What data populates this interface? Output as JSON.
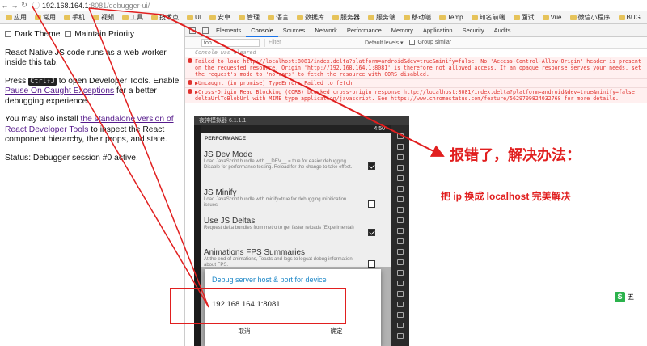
{
  "browser": {
    "url_host": "192.168.164.1",
    "url_path": ":8081/debugger-ui/",
    "bookmarks": [
      "应用",
      "常用",
      "手机",
      "视频",
      "工具",
      "技术点",
      "UI",
      "安卓",
      "管理",
      "语言",
      "数据库",
      "服务器",
      "服务端",
      "移动端",
      "Temp",
      "知名前端",
      "面试",
      "Vue",
      "微信小程序",
      "BUG"
    ]
  },
  "page": {
    "dark_theme": "Dark Theme",
    "maintain_priority": "Maintain Priority",
    "intro": "React Native JS code runs as a web worker inside this tab.",
    "press": "Press ",
    "shortcut": "Ctrl⇧J",
    "to_open": " to open Developer Tools. Enable ",
    "pause_link": "Pause On Caught Exceptions",
    "better": " for a better debugging experience.",
    "install_prefix": "You may also install ",
    "install_link": "the standalone version of React Developer Tools",
    "install_suffix": " to inspect the React component hierarchy, their props, and state.",
    "status": "Status: Debugger session #0 active."
  },
  "devtools": {
    "tabs": [
      "Elements",
      "Console",
      "Sources",
      "Network",
      "Performance",
      "Memory",
      "Application",
      "Security",
      "Audits"
    ],
    "active_tab": "Console",
    "context": "top",
    "filter_placeholder": "Filter",
    "levels": "Default levels ▾",
    "group_similar": "Group similar",
    "cleared": "Console was cleared",
    "err1": "Failed to load http://localhost:8081/index.delta?platform=android&dev=true&minify=false: No 'Access-Control-Allow-Origin' header is present on the requested resource. Origin 'http://192.168.164.1:8081' is therefore not allowed access. If an opaque response serves your needs, set the request's mode to 'no-cors' to fetch the resource with CORS disabled.",
    "err2": "▶Uncaught (in promise) TypeError: Failed to fetch",
    "err3": "▶Cross-Origin Read Blocking (CORB) blocked cross-origin response http://localhost:8081/index.delta?platform=android&dev=true&minify=false  deltaUrlToBlobUrl with MIME type application/javascript. See https://www.chromestatus.com/feature/5629709824032768 for more details."
  },
  "emulator": {
    "title": "夜神模拟器 6.1.1.1",
    "time": "4:50",
    "section": "PERFORMANCE",
    "settings": [
      {
        "title": "JS Dev Mode",
        "desc": "Load JavaScript bundle with __DEV__ = true for easier debugging. Disable for performance testing. Reload for the change to take effect.",
        "checked": true
      },
      {
        "title": "JS Minify",
        "desc": "Load JavaScript bundle with minify=true for debugging minification issues",
        "checked": false
      },
      {
        "title": "Use JS Deltas",
        "desc": "Request delta bundles from metro to get faster reloads (Experimental)",
        "checked": true
      },
      {
        "title": "Animations FPS Summaries",
        "desc": "At the end of animations, Toasts and logs to logcat debug information about FPS.",
        "checked": false
      }
    ],
    "dialog": {
      "title": "Debug server host & port for device",
      "value": "192.168.164.1:8081",
      "cancel": "取消",
      "ok": "确定"
    }
  },
  "annotation": {
    "main": "报错了，解决办法：",
    "sub": "把 ip 换成 localhost 完美解决",
    "color": "#e11f1f"
  },
  "badge": "五"
}
